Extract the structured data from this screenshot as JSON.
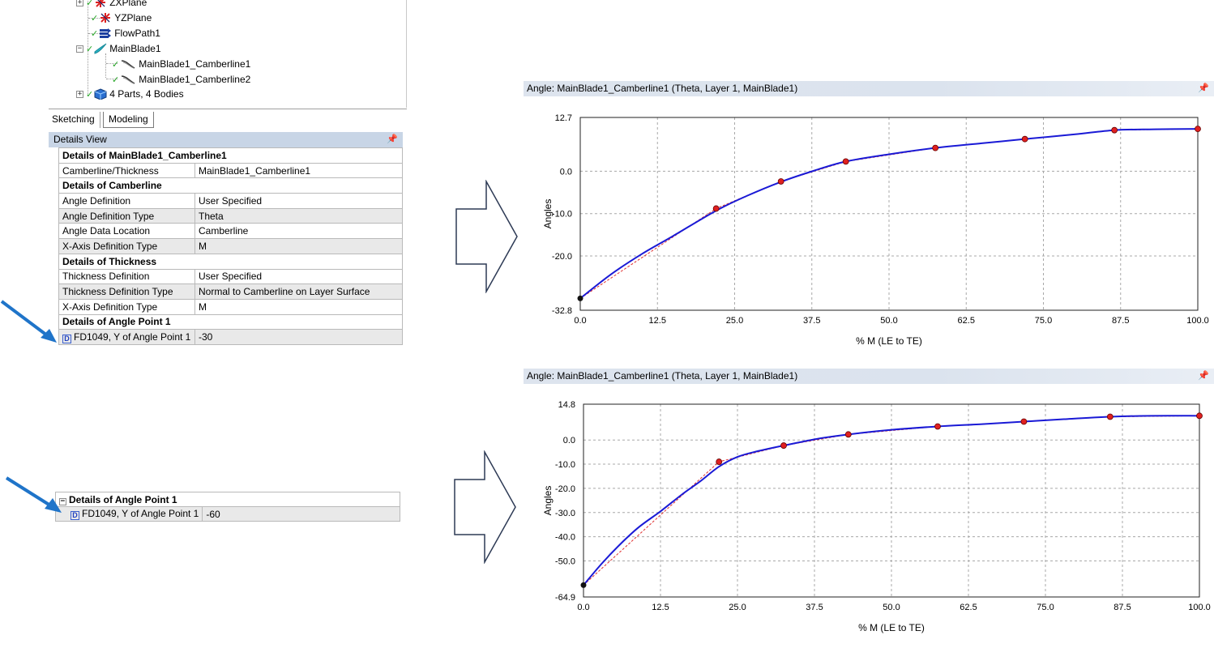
{
  "tree": {
    "items": [
      {
        "label": "ZXPlane",
        "icon": "plane-axes-icon"
      },
      {
        "label": "YZPlane",
        "icon": "plane-axes-icon"
      },
      {
        "label": "FlowPath1",
        "icon": "flowpath-icon"
      },
      {
        "label": "MainBlade1",
        "icon": "blade-icon"
      },
      {
        "label": "MainBlade1_Camberline1",
        "icon": "curve-icon"
      },
      {
        "label": "MainBlade1_Camberline2",
        "icon": "curve-icon"
      },
      {
        "label": "4 Parts, 4 Bodies",
        "icon": "parts-cube-icon"
      }
    ]
  },
  "tabs": {
    "sketching": "Sketching",
    "modeling": "Modeling"
  },
  "details_view": {
    "title": "Details View",
    "rows": [
      {
        "type": "section",
        "label": "Details of MainBlade1_Camberline1"
      },
      {
        "type": "row",
        "key": "Camberline/Thickness",
        "value": "MainBlade1_Camberline1"
      },
      {
        "type": "section",
        "label": "Details of Camberline"
      },
      {
        "type": "row",
        "key": "Angle Definition",
        "value": "User Specified"
      },
      {
        "type": "row",
        "key": "Angle Definition Type",
        "value": "Theta"
      },
      {
        "type": "row",
        "key": "Angle Data Location",
        "value": "Camberline"
      },
      {
        "type": "row",
        "key": "X-Axis Definition Type",
        "value": "M"
      },
      {
        "type": "section",
        "label": "Details of Thickness"
      },
      {
        "type": "row",
        "key": "Thickness Definition",
        "value": "User Specified"
      },
      {
        "type": "row",
        "key": "Thickness Definition Type",
        "value": "Normal to Camberline on Layer Surface"
      },
      {
        "type": "row",
        "key": "X-Axis Definition Type",
        "value": "M"
      },
      {
        "type": "section",
        "label": "Details of Angle Point 1"
      },
      {
        "type": "param",
        "key": "FD1049,  Y of Angle Point 1",
        "value": "-30"
      }
    ]
  },
  "details_small": {
    "section": "Details of Angle Point 1",
    "param_key": "FD1049,  Y of Angle Point 1",
    "param_value": "-60"
  },
  "colors": {
    "arrow": "#1f74c9",
    "curve": "#1a1ad6",
    "spline": "#e03030",
    "point": "#e02020",
    "header": "#dbe3ee"
  },
  "chart_data": [
    {
      "type": "line",
      "title": "Angle: MainBlade1_Camberline1 (Theta, Layer 1, MainBlade1)",
      "xlabel": "% M (LE to TE)",
      "ylabel": "Angles",
      "xlim": [
        0.0,
        100.0
      ],
      "ylim": [
        -32.8,
        12.7
      ],
      "x_ticks": [
        "0.0",
        "12.5",
        "25.0",
        "37.5",
        "50.0",
        "62.5",
        "75.0",
        "87.5",
        "100.0"
      ],
      "y_ticks": [
        {
          "v": 12.7,
          "label": "12.7"
        },
        {
          "v": 0.0,
          "label": "0.0"
        },
        {
          "v": -10.0,
          "label": "-10.0"
        },
        {
          "v": -20.0,
          "label": "-20.0"
        },
        {
          "v": -32.8,
          "label": "-32.8"
        }
      ],
      "grid": true,
      "control_points": {
        "x": [
          0.0,
          22.0,
          32.5,
          43.0,
          57.5,
          72.0,
          86.5,
          100.0
        ],
        "y": [
          -30.0,
          -8.8,
          -2.4,
          2.3,
          5.5,
          7.6,
          9.7,
          10.0
        ]
      },
      "curve": {
        "x": [
          0,
          5,
          10,
          15,
          22,
          27,
          32.5,
          38,
          43,
          50,
          57.5,
          65,
          72,
          80,
          86.5,
          93,
          100
        ],
        "y": [
          -30,
          -24.3,
          -19.5,
          -15.3,
          -9.3,
          -5.8,
          -2.5,
          0.2,
          2.3,
          4.0,
          5.5,
          6.6,
          7.6,
          8.7,
          9.7,
          9.9,
          10.0
        ]
      }
    },
    {
      "type": "line",
      "title": "Angle: MainBlade1_Camberline1 (Theta, Layer 1, MainBlade1)",
      "xlabel": "% M (LE to TE)",
      "ylabel": "Angles",
      "xlim": [
        0.0,
        100.0
      ],
      "ylim": [
        -64.9,
        14.8
      ],
      "x_ticks": [
        "0.0",
        "12.5",
        "25.0",
        "37.5",
        "50.0",
        "62.5",
        "75.0",
        "87.5",
        "100.0"
      ],
      "y_ticks": [
        {
          "v": 14.8,
          "label": "14.8"
        },
        {
          "v": 0.0,
          "label": "0.0"
        },
        {
          "v": -10.0,
          "label": "-10.0"
        },
        {
          "v": -20.0,
          "label": "-20.0"
        },
        {
          "v": -30.0,
          "label": "-30.0"
        },
        {
          "v": -40.0,
          "label": "-40.0"
        },
        {
          "v": -50.0,
          "label": "-50.0"
        },
        {
          "v": -64.9,
          "label": "-64.9"
        }
      ],
      "grid": true,
      "control_points": {
        "x": [
          0.0,
          22.0,
          32.5,
          43.0,
          57.5,
          71.5,
          85.5,
          100.0
        ],
        "y": [
          -60.0,
          -9.0,
          -2.3,
          2.3,
          5.6,
          7.6,
          9.6,
          10.0
        ]
      },
      "curve": {
        "x": [
          0,
          3,
          6,
          9,
          12.5,
          16,
          19,
          22,
          25,
          28,
          32.5,
          38,
          43,
          50,
          57.5,
          65,
          71.5,
          78,
          85.5,
          92,
          100
        ],
        "y": [
          -60,
          -51,
          -43,
          -36,
          -29.5,
          -22.5,
          -17,
          -11,
          -7,
          -4.8,
          -2.3,
          0.5,
          2.3,
          4.2,
          5.6,
          6.6,
          7.6,
          8.6,
          9.6,
          10.0,
          10.0
        ]
      }
    }
  ]
}
